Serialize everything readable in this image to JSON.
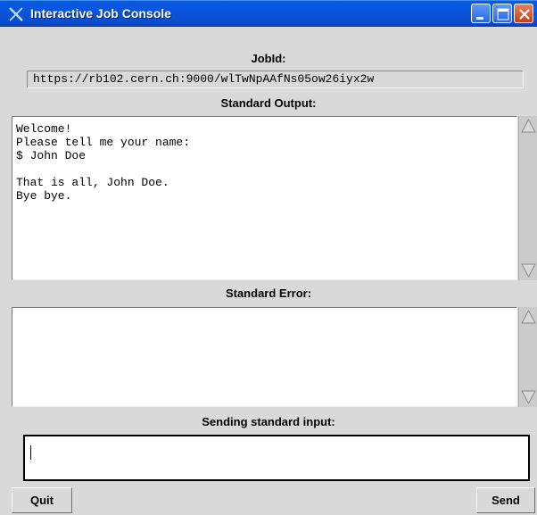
{
  "window": {
    "title": "Interactive Job Console",
    "icon": "x-logo-icon",
    "controls": [
      "minimize-icon",
      "maximize-icon",
      "close-icon"
    ]
  },
  "jobid": {
    "label": "JobId:",
    "value": "https://rb102.cern.ch:9000/wlTwNpAAfNs05ow26iyx2w"
  },
  "stdout": {
    "label": "Standard Output:",
    "text": "Welcome!\nPlease tell me your name:\n$ John Doe\n\nThat is all, John Doe.\nBye bye."
  },
  "stderr": {
    "label": "Standard Error:",
    "text": ""
  },
  "stdin": {
    "label": "Sending standard input:",
    "value": ""
  },
  "buttons": {
    "quit": "Quit",
    "send": "Send"
  },
  "colors": {
    "titlebar": "#0a5ad8",
    "close_button": "#d4512a",
    "window_bg": "#d9d9d9"
  }
}
